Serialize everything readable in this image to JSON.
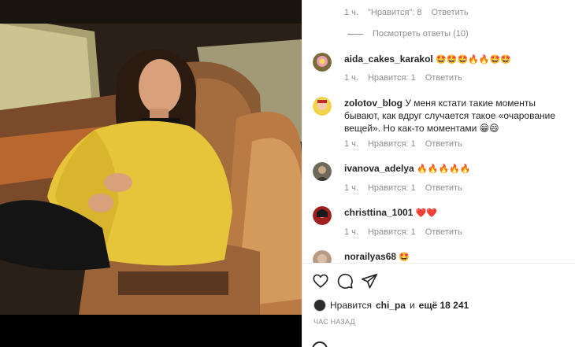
{
  "top_comment_meta": {
    "time": "1 ч.",
    "likes": "\"Нравится\": 8",
    "reply": "Ответить"
  },
  "view_replies": "Посмотреть ответы (10)",
  "comments": [
    {
      "user": "aida_cakes_karakol",
      "text": "🤩🤩🤩🔥🔥🤩🤩",
      "time": "1 ч.",
      "likes": "Нравится: 1",
      "reply": "Ответить"
    },
    {
      "user": "zolotov_blog",
      "text": "У меня кстати такие моменты бывают, как вдруг случается такое «очарование вещей». Но как-то моментами 😁😄",
      "time": "1 ч.",
      "likes": "Нравится: 1",
      "reply": "Ответить"
    },
    {
      "user": "ivanova_adelya",
      "text": "🔥🔥🔥🔥🔥",
      "time": "1 ч.",
      "likes": "Нравится: 1",
      "reply": "Ответить"
    },
    {
      "user": "christtina_1001",
      "text": "❤️❤️",
      "time": "1 ч.",
      "likes": "Нравится: 1",
      "reply": "Ответить"
    },
    {
      "user": "norailyas68",
      "text": "🤩",
      "time": "",
      "likes": "",
      "reply": ""
    }
  ],
  "icons": {
    "like": "heart-icon",
    "comment": "comment-bubble-icon",
    "share": "paper-plane-icon"
  },
  "likes_line": {
    "prefix": "Нравится",
    "user": "chi_pa",
    "middle": "и",
    "count": "ещё 18 241"
  },
  "posted": "ЧАС НАЗАД",
  "colors": {
    "text": "#262626",
    "secondary": "#8e8e8e",
    "border": "#efefef",
    "coat": "#e8c93a"
  }
}
